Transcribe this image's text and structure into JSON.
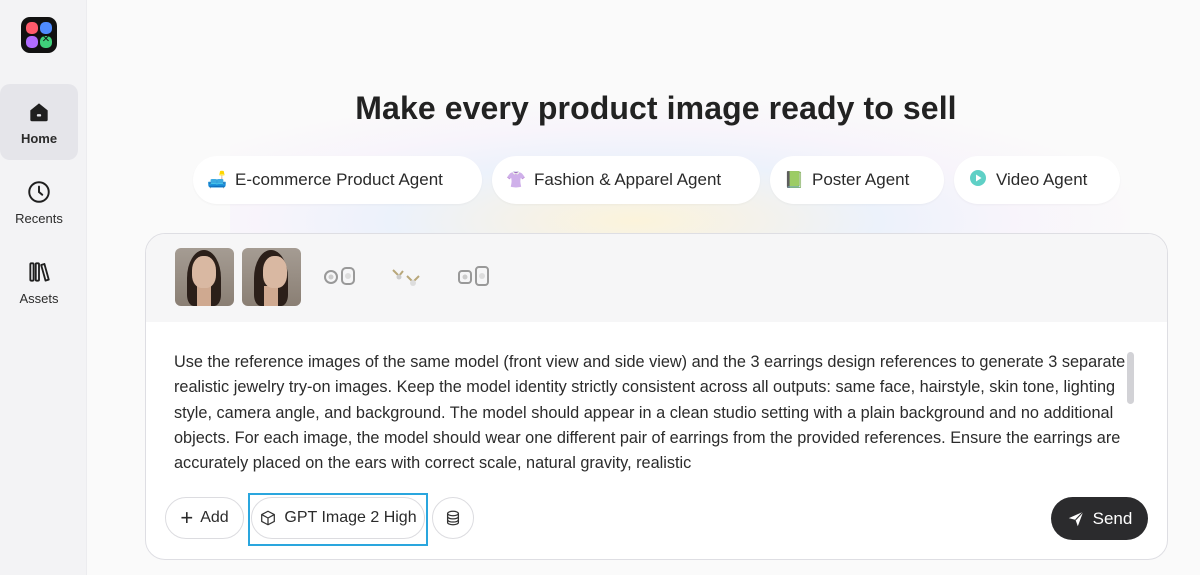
{
  "sidebar": {
    "items": [
      {
        "label": "Home",
        "icon": "home-icon",
        "active": true
      },
      {
        "label": "Recents",
        "icon": "clock-icon",
        "active": false
      },
      {
        "label": "Assets",
        "icon": "library-icon",
        "active": false
      }
    ]
  },
  "headline": "Make every product image ready to sell",
  "agents": [
    {
      "label": "E-commerce Product Agent",
      "icon": "🛋️"
    },
    {
      "label": "Fashion & Apparel Agent",
      "icon": "👚"
    },
    {
      "label": "Poster Agent",
      "icon": "📗"
    },
    {
      "label": "Video Agent",
      "icon": "▶"
    }
  ],
  "composer": {
    "prompt": "Use the reference images of the same model (front view and side view) and the 3 earrings design references to generate 3 separate realistic jewelry try-on images. Keep the model identity strictly consistent across all outputs: same face, hairstyle, skin tone, lighting style, camera angle, and background. The model should appear in a clean studio setting with a plain background and no additional objects. For each image, the model should wear one different pair of earrings from the provided references. Ensure the earrings are accurately placed on the ears with correct scale, natural gravity, realistic",
    "add_label": "Add",
    "model_label": "GPT Image 2 High",
    "send_label": "Send"
  },
  "colors": {
    "accent_outline": "#2aa6de",
    "send_bg": "#2b2b2d"
  }
}
